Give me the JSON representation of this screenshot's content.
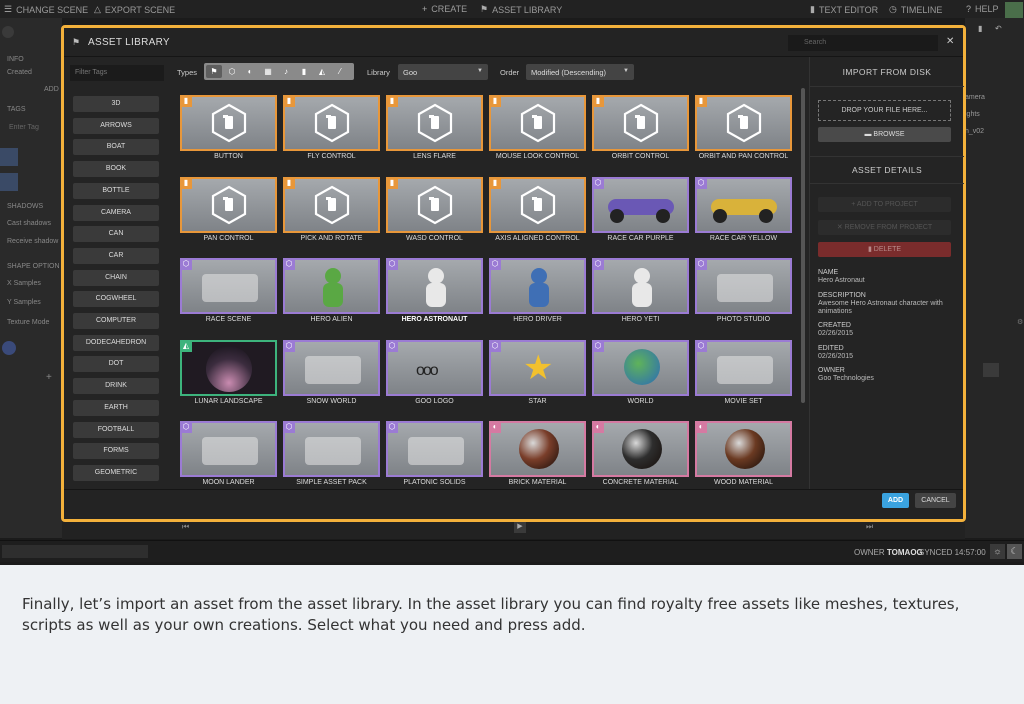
{
  "topbar": {
    "change_scene": "CHANGE SCENE",
    "export_scene": "EXPORT SCENE",
    "create": "CREATE",
    "asset_library": "ASSET LIBRARY",
    "text_editor": "TEXT EDITOR",
    "timeline": "TIMELINE",
    "help": "HELP"
  },
  "left_panel": {
    "info": "INFO",
    "created": "Created",
    "add": "ADD",
    "tags": "TAGS",
    "enter_tag": "Enter Tag",
    "shadows": "SHADOWS",
    "cast_shadows": "Cast shadows",
    "receive_shadows": "Receive shadow",
    "shape_options": "SHAPE OPTION",
    "x_samples": "X Samples",
    "y_samples": "Y Samples",
    "texture_mode": "Texture Mode"
  },
  "right_strip": {
    "camera": "amera",
    "lights": "ights",
    "hero": "h_v02"
  },
  "modal": {
    "title": "ASSET LIBRARY",
    "search_placeholder": "Search",
    "filter_tags_placeholder": "Filter Tags",
    "types_label": "Types",
    "library_label": "Library",
    "library_value": "Goo",
    "order_label": "Order",
    "order_value": "Modified (Descending)",
    "tags": [
      "3D",
      "ARROWS",
      "BOAT",
      "BOOK",
      "BOTTLE",
      "CAMERA",
      "CAN",
      "CAR",
      "CHAIN",
      "COGWHEEL",
      "COMPUTER",
      "DODECAHEDRON",
      "DOT",
      "DRINK",
      "EARTH",
      "FOOTBALL",
      "FORMS",
      "GEOMETRIC"
    ],
    "assets": [
      {
        "label": "BUTTON",
        "kind": "script"
      },
      {
        "label": "FLY CONTROL",
        "kind": "script"
      },
      {
        "label": "LENS FLARE",
        "kind": "script"
      },
      {
        "label": "MOUSE LOOK CONTROL",
        "kind": "script"
      },
      {
        "label": "ORBIT CONTROL",
        "kind": "script"
      },
      {
        "label": "ORBIT AND PAN CONTROL",
        "kind": "script"
      },
      {
        "label": "PAN CONTROL",
        "kind": "script"
      },
      {
        "label": "PICK AND ROTATE",
        "kind": "script"
      },
      {
        "label": "WASD CONTROL",
        "kind": "script"
      },
      {
        "label": "AXIS ALIGNED CONTROL",
        "kind": "script"
      },
      {
        "label": "RACE CAR PURPLE",
        "kind": "mesh"
      },
      {
        "label": "RACE CAR YELLOW",
        "kind": "mesh"
      },
      {
        "label": "RACE SCENE",
        "kind": "mesh"
      },
      {
        "label": "HERO ALIEN",
        "kind": "mesh"
      },
      {
        "label": "HERO ASTRONAUT",
        "kind": "mesh",
        "selected": true
      },
      {
        "label": "HERO DRIVER",
        "kind": "mesh"
      },
      {
        "label": "HERO YETI",
        "kind": "mesh"
      },
      {
        "label": "PHOTO STUDIO",
        "kind": "mesh"
      },
      {
        "label": "LUNAR LANDSCAPE",
        "kind": "tex"
      },
      {
        "label": "SNOW WORLD",
        "kind": "mesh"
      },
      {
        "label": "GOO LOGO",
        "kind": "mesh"
      },
      {
        "label": "STAR",
        "kind": "mesh"
      },
      {
        "label": "WORLD",
        "kind": "mesh"
      },
      {
        "label": "MOVIE SET",
        "kind": "mesh"
      },
      {
        "label": "MOON LANDER",
        "kind": "mesh"
      },
      {
        "label": "SIMPLE ASSET PACK",
        "kind": "mesh"
      },
      {
        "label": "PLATONIC SOLIDS",
        "kind": "mesh"
      },
      {
        "label": "BRICK MATERIAL",
        "kind": "mat"
      },
      {
        "label": "CONCRETE MATERIAL",
        "kind": "mat"
      },
      {
        "label": "WOOD MATERIAL",
        "kind": "mat"
      }
    ],
    "import_heading": "IMPORT FROM DISK",
    "drop_zone": "DROP YOUR FILE HERE...",
    "browse": "BROWSE",
    "asset_details_heading": "ASSET DETAILS",
    "add_to_project": "ADD TO PROJECT",
    "remove_from_project": "REMOVE FROM PROJECT",
    "delete": "DELETE",
    "details": {
      "name_label": "NAME",
      "name_value": "Hero Astronaut",
      "description_label": "DESCRIPTION",
      "description_value": "Awesome Hero Astronaut character with animations",
      "created_label": "CREATED",
      "created_value": "02/26/2015",
      "edited_label": "EDITED",
      "edited_value": "02/26/2015",
      "owner_label": "OWNER",
      "owner_value": "Goo Technologies"
    },
    "add_button": "ADD",
    "cancel_button": "CANCEL"
  },
  "bottom_bar": {
    "owner_label": "OWNER",
    "owner_value": "TOMAOG",
    "synced": "SYNCED 14:57:00"
  },
  "caption": "Finally, let’s import an asset from the asset library. In the asset library you can find royalty free assets like meshes, textures, scripts as well as your own creations. Select what you need and press add.",
  "colors": {
    "frame_highlight": "#f3b13b",
    "script_border": "#e8973a",
    "mesh_border": "#9b7bd4",
    "texture_border": "#3db37d",
    "material_border": "#d57aa2",
    "add_button": "#3aa3e0"
  }
}
